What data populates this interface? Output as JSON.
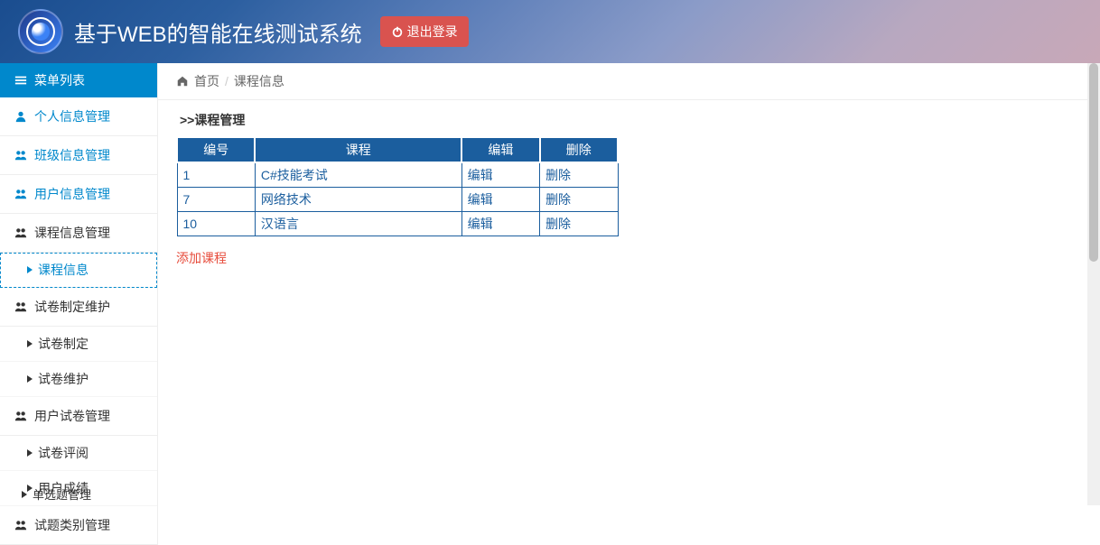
{
  "header": {
    "title": "基于WEB的智能在线测试系统",
    "logout_label": "退出登录"
  },
  "sidebar": {
    "menu_header": "菜单列表",
    "items": [
      {
        "label": "个人信息管理",
        "blue": true,
        "icon": "user"
      },
      {
        "label": "班级信息管理",
        "blue": true,
        "icon": "users"
      },
      {
        "label": "用户信息管理",
        "blue": true,
        "icon": "users"
      },
      {
        "label": "课程信息管理",
        "blue": false,
        "icon": "stack"
      },
      {
        "label": "试卷制定维护",
        "blue": false,
        "icon": "stack"
      },
      {
        "label": "用户试卷管理",
        "blue": false,
        "icon": "stack"
      },
      {
        "label": "试题类别管理",
        "blue": false,
        "icon": "stack"
      }
    ],
    "sub_course": {
      "label": "课程信息"
    },
    "sub_paper_make": {
      "label": "试卷制定"
    },
    "sub_paper_maint": {
      "label": "试卷维护"
    },
    "sub_review": {
      "label": "试卷评阅"
    },
    "sub_score": {
      "label": "用户成绩"
    },
    "bottom_cut": "单选题管理"
  },
  "breadcrumb": {
    "home": "首页",
    "current": "课程信息"
  },
  "main": {
    "section_title": ">>课程管理",
    "add_label": "添加课程",
    "table": {
      "headers": {
        "id": "编号",
        "course": "课程",
        "edit": "编辑",
        "del": "删除"
      },
      "rows": [
        {
          "id": "1",
          "course": "C#技能考试",
          "edit": "编辑",
          "del": "删除"
        },
        {
          "id": "7",
          "course": "网络技术",
          "edit": "编辑",
          "del": "删除"
        },
        {
          "id": "10",
          "course": "汉语言",
          "edit": "编辑",
          "del": "删除"
        }
      ]
    }
  }
}
